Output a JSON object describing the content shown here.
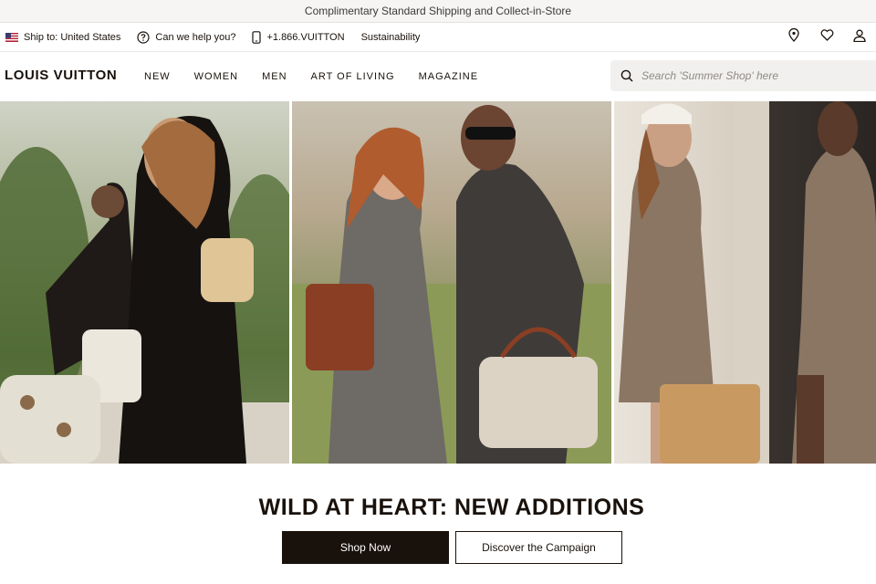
{
  "announcement": {
    "text": "Complimentary Standard Shipping and Collect-in-Store"
  },
  "utility": {
    "ship_to": "Ship to: United States",
    "help": "Can we help you?",
    "phone": "+1.866.VUITTON",
    "sustainability": "Sustainability",
    "icons": [
      "flag-icon",
      "help-circle-icon",
      "phone-icon",
      "location-pin-icon",
      "heart-icon",
      "user-icon"
    ]
  },
  "nav": {
    "logo": "LOUIS VUITTON",
    "links": [
      "NEW",
      "WOMEN",
      "MEN",
      "ART OF LIVING",
      "MAGAZINE"
    ],
    "search_placeholder": "Search 'Summer Shop' here"
  },
  "campaign": {
    "title": "WILD AT HEART: NEW ADDITIONS",
    "primary_cta": "Shop Now",
    "secondary_cta": "Discover the Campaign"
  },
  "colors": {
    "brand_dark": "#19110b",
    "announce_bg": "#f6f5f3",
    "search_bg": "#f1f0ee"
  }
}
